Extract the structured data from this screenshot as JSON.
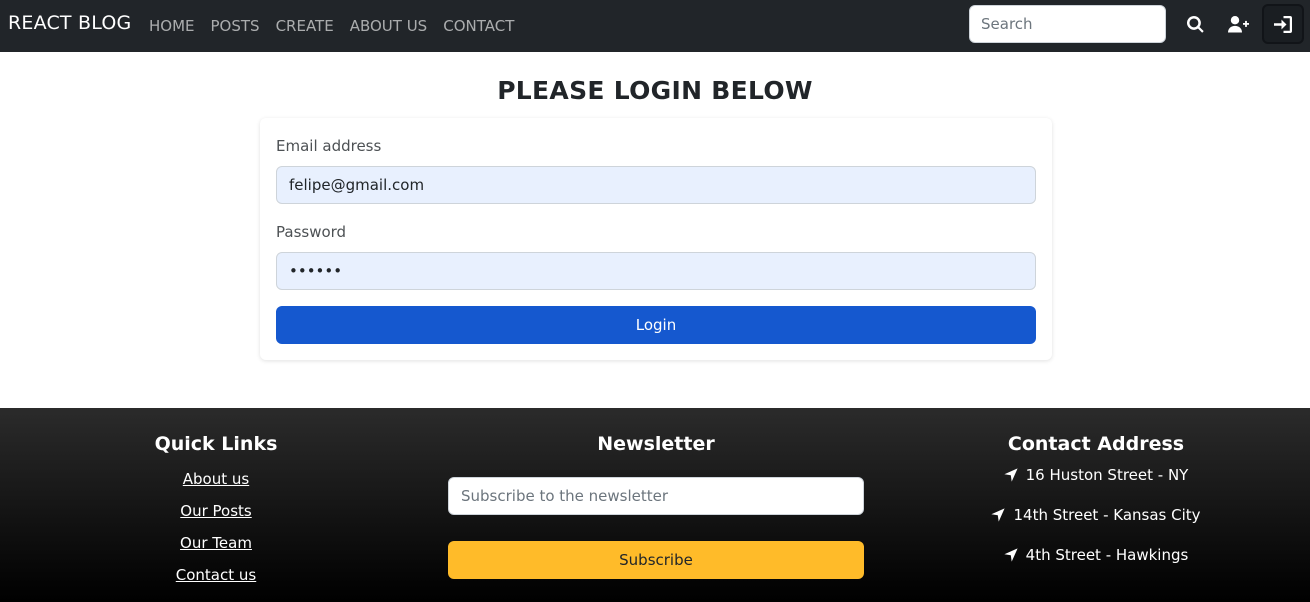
{
  "navbar": {
    "brand": "REACT BLOG",
    "links": [
      "HOME",
      "POSTS",
      "CREATE",
      "ABOUT US",
      "CONTACT"
    ],
    "search_placeholder": "Search",
    "icons": [
      "search-icon",
      "user-plus-icon",
      "sign-in-icon"
    ]
  },
  "main": {
    "title": "PLEASE LOGIN BELOW",
    "email_label": "Email address",
    "email_value": "felipe@gmail.com",
    "password_label": "Password",
    "password_value": "••••••",
    "login_label": "Login"
  },
  "footer": {
    "quick_links": {
      "heading": "Quick Links",
      "items": [
        "About us",
        "Our Posts",
        "Our Team",
        "Contact us"
      ]
    },
    "newsletter": {
      "heading": "Newsletter",
      "placeholder": "Subscribe to the newsletter",
      "button_label": "Subscribe"
    },
    "contact": {
      "heading": "Contact Address",
      "icon": "location-arrow-icon",
      "addresses": [
        "16 Huston Street - NY",
        "14th Street - Kansas City",
        "4th Street - Hawkings"
      ]
    }
  },
  "colors": {
    "navbar_bg": "#212529",
    "primary_button": "#1558cf",
    "subscribe_button": "#ffbb29",
    "input_autofill_bg": "#e8f0fe"
  }
}
